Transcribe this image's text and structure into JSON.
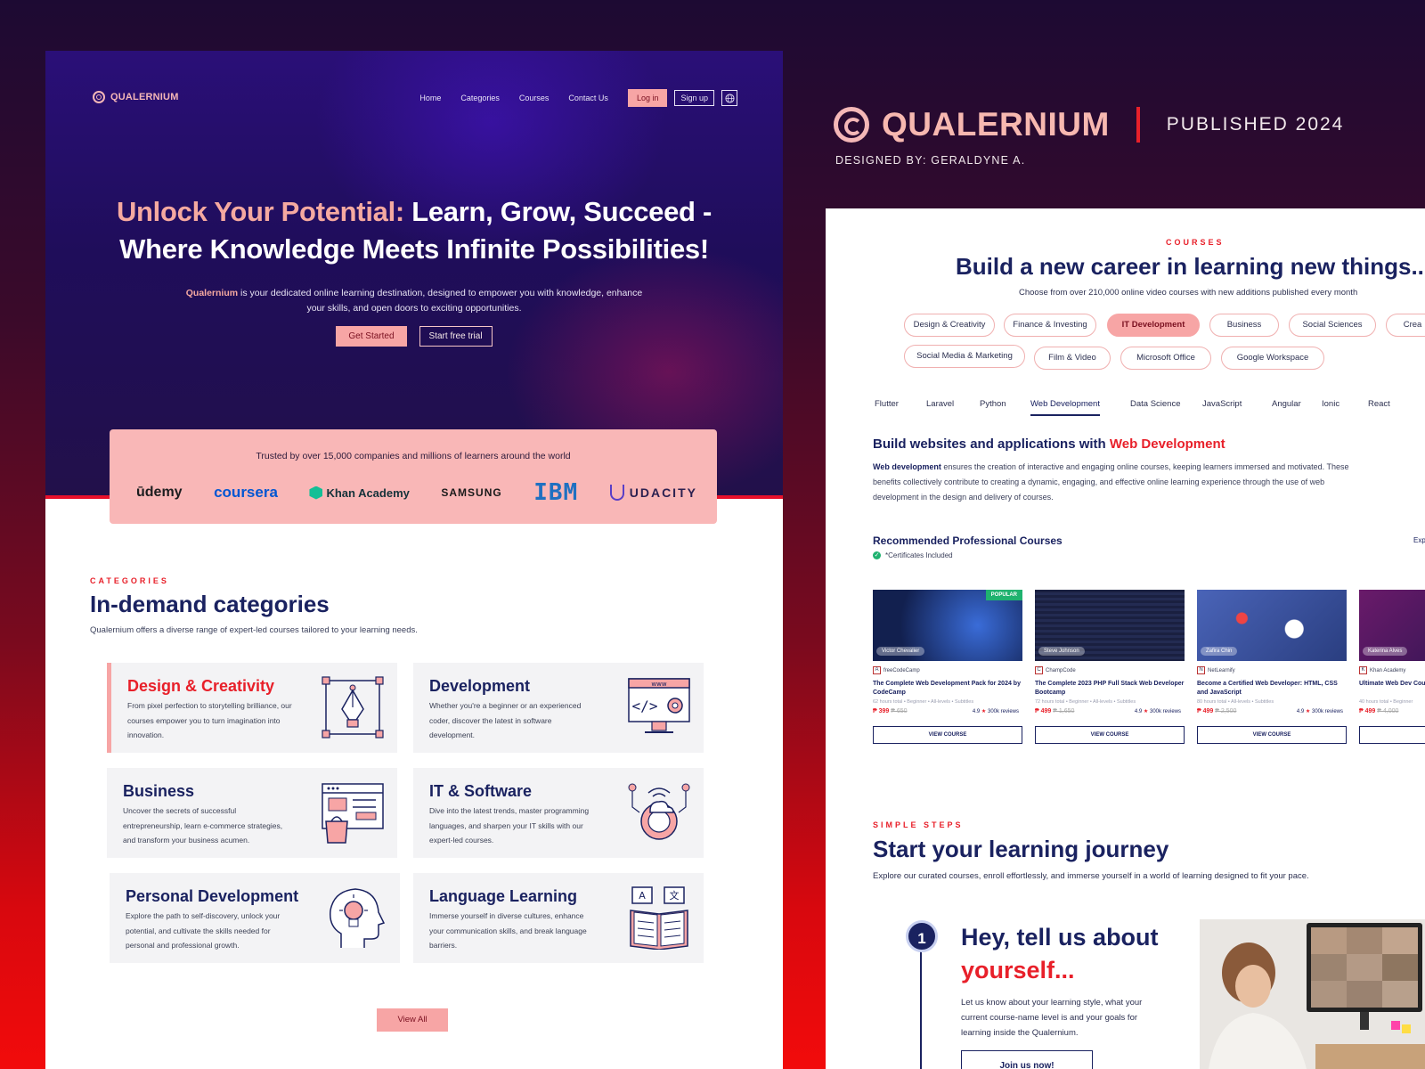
{
  "brand": {
    "name": "QUALERNIUM",
    "published": "PUBLISHED 2024",
    "designer": "DESIGNED BY: GERALDYNE A."
  },
  "left": {
    "nav": {
      "logo": "QUALERNIUM",
      "links": [
        "Home",
        "Categories",
        "Courses",
        "Contact Us"
      ],
      "login": "Log in",
      "signup": "Sign up",
      "globe_icon": "globe-icon"
    },
    "hero": {
      "title_accent": "Unlock Your Potential:",
      "title_rest_1": " Learn, Grow, Succeed -",
      "title_line_2": "Where Knowledge Meets Infinite Possibilities!",
      "subtitle_brand": "Qualernium",
      "subtitle_rest": " is your dedicated online learning destination, designed to empower you with knowledge, enhance your skills, and open doors to exciting opportunities.",
      "cta_primary": "Get Started",
      "cta_secondary": "Start free trial"
    },
    "trusted": {
      "text": "Trusted by over 15,000 companies and millions of learners around the world",
      "logos": [
        "ūdemy",
        "coursera",
        "Khan Academy",
        "SAMSUNG",
        "IBM",
        "UDACITY"
      ]
    },
    "categories": {
      "eyebrow": "CATEGORIES",
      "title": "In-demand categories",
      "subtitle": "Qualernium offers a diverse range of expert-led courses tailored to your learning needs.",
      "items": [
        {
          "title": "Design & Creativity",
          "desc": "From pixel perfection to storytelling brilliance, our courses empower you to turn imagination into innovation.",
          "icon": "pen-tool-icon"
        },
        {
          "title": "Development",
          "desc": "Whether you're a beginner or an experienced coder, discover the latest in software development.",
          "icon": "code-monitor-icon"
        },
        {
          "title": "Business",
          "desc": "Uncover the secrets of successful entrepreneurship, learn e-commerce strategies, and transform your business acumen.",
          "icon": "ecommerce-icon"
        },
        {
          "title": "IT & Software",
          "desc": "Dive into the latest trends, master programming languages, and sharpen your IT skills with our expert-led courses.",
          "icon": "cloud-gear-icon"
        },
        {
          "title": "Personal Development",
          "desc": "Explore the path to self-discovery, unlock your potential, and cultivate the skills needed for personal and professional growth.",
          "icon": "head-bulb-icon"
        },
        {
          "title": "Language Learning",
          "desc": "Immerse yourself in diverse cultures, enhance your communication skills, and break language barriers.",
          "icon": "translate-book-icon"
        }
      ],
      "view_all": "View All"
    }
  },
  "right": {
    "courses": {
      "eyebrow": "COURSES",
      "title": "Build a new career in learning new things...",
      "subtitle": "Choose from over 210,000 online video courses with new additions published every month",
      "chips_row1": [
        "Design & Creativity",
        "Finance & Investing",
        "IT Development",
        "Business",
        "Social Sciences",
        "Crea"
      ],
      "chips_row2": [
        "Social Media & Marketing",
        "Film & Video",
        "Microsoft Office",
        "Google Workspace"
      ],
      "selected_chip": "IT Development",
      "tabs": [
        "Flutter",
        "Laravel",
        "Python",
        "Web Development",
        "Data Science",
        "JavaScript",
        "Angular",
        "Ionic",
        "React"
      ],
      "selected_tab": "Web Development"
    },
    "webdev": {
      "title_lead": "Build websites and applications with ",
      "title_accent": "Web Development",
      "desc_bold": "Web development",
      "desc_rest": " ensures the creation of interactive and engaging online courses, keeping learners immersed and motivated. These benefits collectively contribute to creating a dynamic, engaging, and effective online learning experience through the use of web development in the design and delivery of courses."
    },
    "recommended": {
      "title": "Recommended Professional Courses",
      "cert": "*Certificates Included",
      "explore": "Exp",
      "cards": [
        {
          "badge": "POPULAR",
          "author": "Victor Chevalier",
          "provider": "freeCodeCamp",
          "provider_icon": "A",
          "title": "The Complete Web Development Pack for 2024 by CodeCamp",
          "meta": "62 hours total  •  Beginner  •  All-levels  •  Subtitles",
          "price": "₱ 399",
          "old_price": "₱ 650",
          "rating": "4.9",
          "reviews": "300k reviews",
          "button": "VIEW COURSE",
          "thumb": "#1a2a6a"
        },
        {
          "badge": "",
          "author": "Steve Johnson",
          "provider": "ChampCode",
          "provider_icon": "C",
          "title": "The Complete 2023 PHP Full Stack Web Developer Bootcamp",
          "meta": "72 hours total  •  Beginner  •  All-levels  •  Subtitles",
          "price": "₱ 499",
          "old_price": "₱ 1,650",
          "rating": "4.9",
          "reviews": "300k reviews",
          "button": "VIEW COURSE",
          "thumb": "#1c2340"
        },
        {
          "badge": "",
          "author": "Zafira Chin",
          "provider": "NetLearnify",
          "provider_icon": "N",
          "title": "Become a Certified Web Developer: HTML, CSS and JavaScript",
          "meta": "80 hours total  •  All-levels  •  Subtitles",
          "price": "₱ 499",
          "old_price": "₱ 2,500",
          "rating": "4.9",
          "reviews": "300k reviews",
          "button": "VIEW COURSE",
          "thumb": "#3a4e8a"
        },
        {
          "badge": "",
          "author": "Katerina Alves",
          "provider": "Khan Academy",
          "provider_icon": "K",
          "title": "Ultimate Web Dev Course",
          "meta": "40 hours total  •  Beginner",
          "price": "₱ 499",
          "old_price": "₱ 4,000",
          "rating": "",
          "reviews": "",
          "button": "",
          "thumb": "#2a1550"
        }
      ]
    },
    "steps": {
      "eyebrow": "SIMPLE STEPS",
      "title": "Start your learning journey",
      "subtitle": "Explore our curated courses, enroll effortlessly, and immerse yourself in a world of learning designed to fit your pace.",
      "step_number": "1",
      "step_title_1": "Hey, tell us about",
      "step_title_2": "yourself...",
      "step_desc": "Let us know about your learning style, what your current course-name level is and your goals for learning inside the Qualernium.",
      "step_button": "Join us now!"
    }
  }
}
